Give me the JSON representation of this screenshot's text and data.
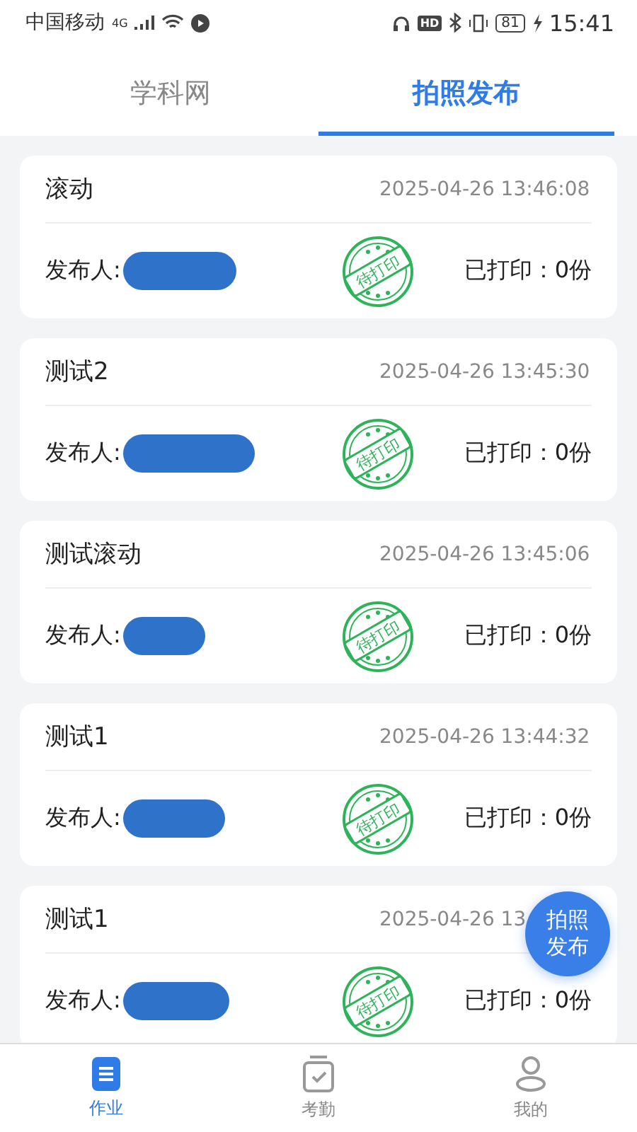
{
  "status_bar": {
    "carrier": "中国移动",
    "network": "4G",
    "hd": "HD",
    "battery": "81",
    "time": "15:41"
  },
  "tabs": [
    {
      "label": "学科网",
      "selected": false
    },
    {
      "label": "拍照发布",
      "selected": true
    }
  ],
  "posts": [
    {
      "title": "滚动",
      "time": "2025-04-26 13:46:08",
      "publisher_label": "发布人:",
      "stamp": "待打印",
      "printed": "已打印：0份"
    },
    {
      "title": "测试2",
      "time": "2025-04-26 13:45:30",
      "publisher_label": "发布人:",
      "stamp": "待打印",
      "printed": "已打印：0份"
    },
    {
      "title": "测试滚动",
      "time": "2025-04-26 13:45:06",
      "publisher_label": "发布人:",
      "stamp": "待打印",
      "printed": "已打印：0份"
    },
    {
      "title": "测试1",
      "time": "2025-04-26 13:44:32",
      "publisher_label": "发布人:",
      "stamp": "待打印",
      "printed": "已打印：0份"
    },
    {
      "title": "测试1",
      "time": "2025-04-26 13",
      "publisher_label": "发布人:",
      "stamp": "待打印",
      "printed": "已打印：0份"
    }
  ],
  "fab": {
    "label": "拍照发布"
  },
  "nav": [
    {
      "label": "作业",
      "kind": "doc",
      "selected": true
    },
    {
      "label": "考勤",
      "kind": "check",
      "selected": false
    },
    {
      "label": "我的",
      "kind": "user",
      "selected": false
    }
  ]
}
